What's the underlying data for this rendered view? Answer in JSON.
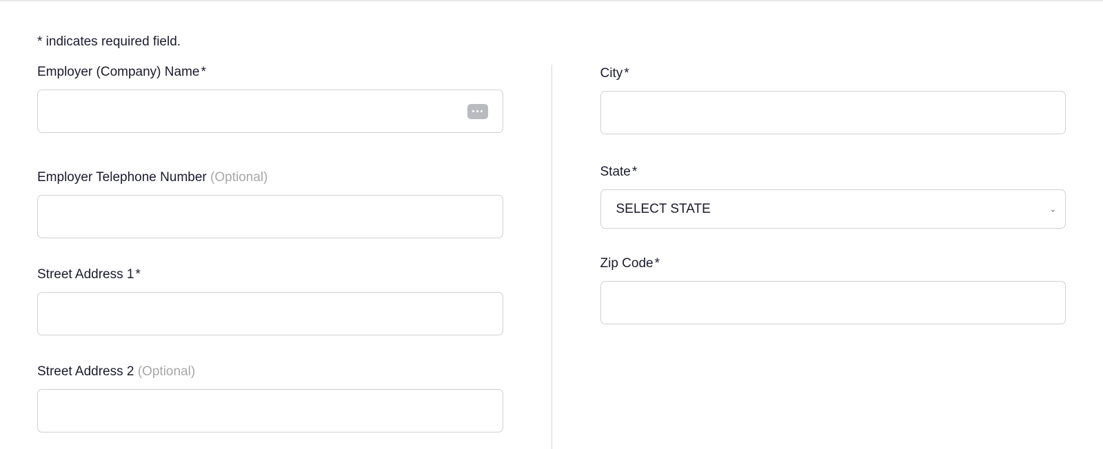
{
  "form": {
    "required_note": "* indicates required field.",
    "left": {
      "employer_name": {
        "label": "Employer (Company) Name",
        "req": "*",
        "value": ""
      },
      "employer_phone": {
        "label": "Employer Telephone Number",
        "optional": "(Optional)",
        "value": ""
      },
      "street1": {
        "label": "Street Address 1",
        "req": "*",
        "value": ""
      },
      "street2": {
        "label": "Street Address 2",
        "optional": "(Optional)",
        "value": ""
      }
    },
    "right": {
      "city": {
        "label": "City",
        "req": "*",
        "value": ""
      },
      "state": {
        "label": "State",
        "req": "*",
        "selected": "SELECT STATE"
      },
      "zip": {
        "label": "Zip Code",
        "req": "*",
        "value": ""
      }
    }
  }
}
